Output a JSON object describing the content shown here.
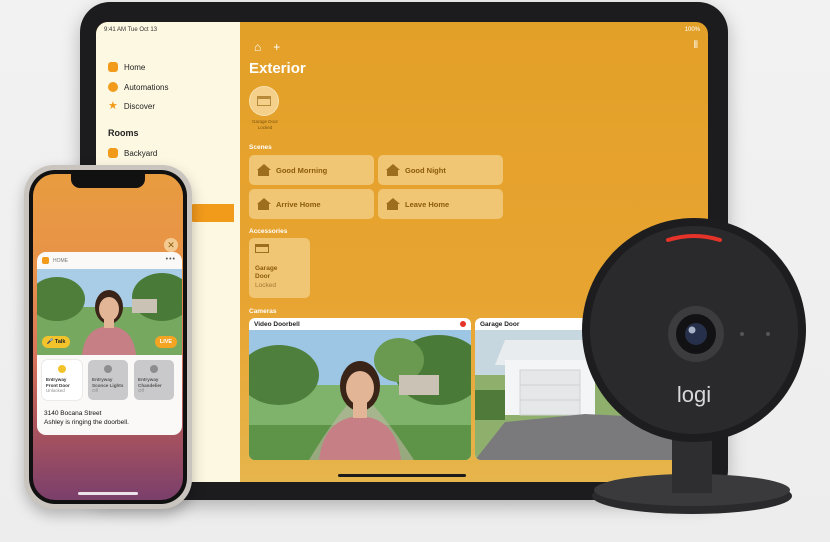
{
  "ipad": {
    "status_time": "9:41 AM  Tue Oct 13",
    "status_battery": "100%",
    "sidebar": {
      "items": [
        {
          "label": "Home",
          "icon": "house-icon"
        },
        {
          "label": "Automations",
          "icon": "clock-icon"
        },
        {
          "label": "Discover",
          "icon": "star-icon"
        }
      ],
      "rooms_title": "Rooms",
      "rooms": [
        {
          "label": "Backyard",
          "icon": "room-icon"
        }
      ]
    },
    "page_title": "Exterior",
    "favorite": {
      "name": "Garage Door",
      "status": "Locked"
    },
    "scenes_label": "Scenes",
    "scenes": [
      "Good Morning",
      "Good Night",
      "Arrive Home",
      "Leave Home"
    ],
    "accessories_label": "Accessories",
    "accessory": {
      "name_line1": "Garage",
      "name_line2": "Door",
      "status": "Locked"
    },
    "cameras_label": "Cameras",
    "cameras": [
      {
        "name": "Video Doorbell",
        "recording": true
      },
      {
        "name": "Garage Door",
        "recording": false
      }
    ]
  },
  "iphone": {
    "notification": {
      "app_name": "HOME",
      "talk_label": "Talk",
      "live_label": "LIVE",
      "tiles": [
        {
          "name_line1": "Entryway",
          "name_line2": "Front Door",
          "state": "Unlocked",
          "on": true
        },
        {
          "name_line1": "Entryway",
          "name_line2": "Sconce Lights",
          "state": "Off",
          "on": false
        },
        {
          "name_line1": "Entryway",
          "name_line2": "Chandelier",
          "state": "Off",
          "on": false
        }
      ],
      "address": "3140 Bocana Street",
      "message": "Ashley is ringing the doorbell."
    }
  },
  "camera_device": {
    "brand": "logi"
  },
  "colors": {
    "accent": "#f29b1b",
    "record": "#e5332a",
    "brand_led": "#e5332a"
  }
}
